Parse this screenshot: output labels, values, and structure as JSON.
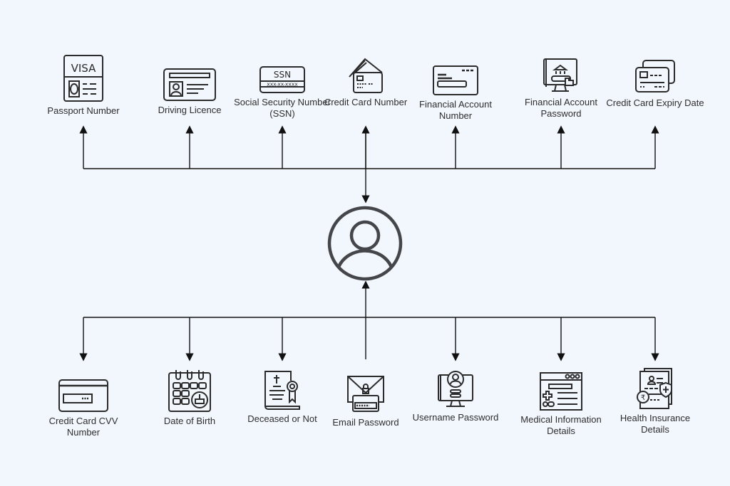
{
  "diagram": {
    "center": {
      "name": "user",
      "icon": "user-avatar-icon"
    },
    "top_nodes": [
      {
        "label": "Passport Number",
        "icon": "visa-passport-icon"
      },
      {
        "label": "Driving Licence",
        "icon": "id-card-icon"
      },
      {
        "label": "Social Security Number (SSN)",
        "icon": "ssn-card-icon",
        "icon_text": "SSN",
        "icon_subtext": "XXX-XX-XXXX"
      },
      {
        "label": "Credit Card Number",
        "icon": "credit-cards-icon"
      },
      {
        "label": "Financial Account Number",
        "icon": "account-card-icon"
      },
      {
        "label": "Financial Account Password",
        "icon": "bank-login-monitor-icon"
      },
      {
        "label": "Credit Card Expiry Date",
        "icon": "stacked-cards-icon"
      }
    ],
    "bottom_nodes": [
      {
        "label": "Credit Card CVV Number",
        "icon": "card-cvv-icon"
      },
      {
        "label": "Date of Birth",
        "icon": "birthday-calendar-icon"
      },
      {
        "label": "Deceased or Not",
        "icon": "death-certificate-icon"
      },
      {
        "label": "Email Password",
        "icon": "email-lock-icon"
      },
      {
        "label": "Username Password",
        "icon": "user-monitor-icon"
      },
      {
        "label": "Medical Information Details",
        "icon": "medical-record-icon"
      },
      {
        "label": "Health Insurance Details",
        "icon": "health-insurance-doc-icon"
      }
    ],
    "colors": {
      "background": "#f2f6fd",
      "line": "#4a4a4a",
      "icon": "#2b2b2b",
      "center": "#45464a"
    }
  }
}
